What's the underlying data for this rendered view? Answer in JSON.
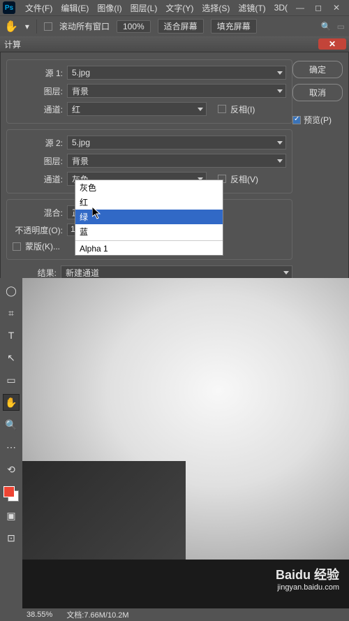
{
  "menubar": {
    "items": [
      "文件(F)",
      "编辑(E)",
      "图像(I)",
      "图层(L)",
      "文字(Y)",
      "选择(S)",
      "滤镜(T)",
      "3D("
    ]
  },
  "optbar": {
    "scroll_all": "滚动所有窗口",
    "zoom": "100%",
    "fit": "适合屏幕",
    "fill": "填充屏幕"
  },
  "dialog": {
    "title": "计算",
    "src1": "源 1:",
    "src2": "源 2:",
    "layer": "图层:",
    "channel": "通道:",
    "blend": "混合:",
    "opacity": "不透明度(O):",
    "mask": "蒙版(K)...",
    "result": "结果:",
    "invert": "反相(I)",
    "invert2": "反相(V)",
    "file_val": "5.jpg",
    "layer_val": "背景",
    "ch1_val": "红",
    "ch2_val": "灰色",
    "blend_val": "正",
    "opacity_val": "1",
    "result_val": "新建通道",
    "ok": "确定",
    "cancel": "取消",
    "preview": "预览(P)"
  },
  "dropdown": {
    "options": [
      "灰色",
      "红",
      "绿",
      "蓝",
      "Alpha 1"
    ],
    "selected_index": 2
  },
  "status": {
    "zoom": "38.55%",
    "doc": "文档:7.66M/10.2M"
  },
  "watermark": {
    "brand": "Baidu 经验",
    "url": "jingyan.baidu.com"
  }
}
